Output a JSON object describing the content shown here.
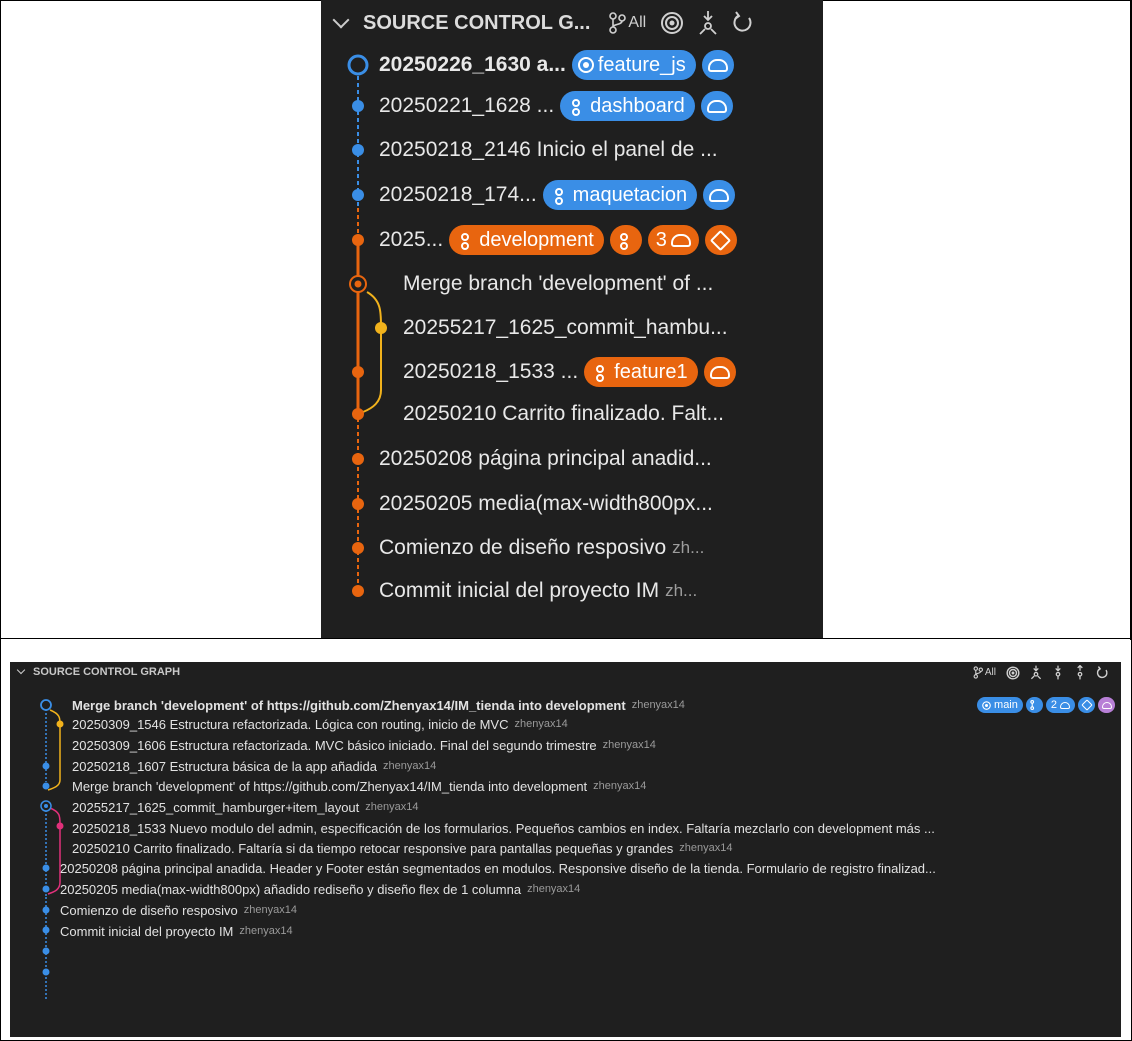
{
  "zoomed_panel": {
    "title": "SOURCE CONTROL G...",
    "all_label": "All",
    "commits": [
      {
        "message": "20250226_1630 a...",
        "author": "",
        "branch": "feature_js",
        "branch_color": "#3a8ee6",
        "marker": "head"
      },
      {
        "message": "20250221_1628 ...",
        "author": "",
        "branch": "dashboard",
        "branch_color": "#3a8ee6",
        "marker": "branch"
      },
      {
        "message": "20250218_2146 Inicio el panel de ...",
        "author": "",
        "branch": "",
        "branch_color": "",
        "marker": ""
      },
      {
        "message": "20250218_174...",
        "author": "",
        "branch": "maquetacion",
        "branch_color": "#3a8ee6",
        "marker": "branch"
      },
      {
        "message": "2025...",
        "author": "",
        "branch": "development",
        "branch_color": "#e8650f",
        "marker": "branch",
        "count": "3"
      },
      {
        "message": "Merge branch 'development' of ...",
        "author": "",
        "branch": "",
        "marker": ""
      },
      {
        "message": "20255217_1625_commit_hambu...",
        "author": "",
        "branch": "",
        "marker": ""
      },
      {
        "message": "20250218_1533 ...",
        "author": "",
        "branch": "feature1",
        "branch_color": "#e8650f",
        "marker": "branch"
      },
      {
        "message": "20250210 Carrito finalizado. Falt...",
        "author": "",
        "branch": "",
        "marker": ""
      },
      {
        "message": "20250208 página principal anadid...",
        "author": "",
        "branch": "",
        "marker": ""
      },
      {
        "message": "20250205 media(max-width800px...",
        "author": "",
        "branch": "",
        "marker": ""
      },
      {
        "message": "Comienzo de diseño resposivo",
        "author": "zh...",
        "branch": "",
        "marker": ""
      },
      {
        "message": "Commit inicial del proyecto IM",
        "author": "zh...",
        "branch": "",
        "marker": ""
      }
    ]
  },
  "full_panel": {
    "title": "SOURCE CONTROL GRAPH",
    "all_label": "All",
    "head_branch": "main",
    "count": "2",
    "commits": [
      {
        "message": "Merge branch 'development' of https://github.com/Zhenyax14/IM_tienda into development",
        "author": "zhenyax14",
        "bold": true
      },
      {
        "message": "20250309_1546 Estructura refactorizada. Lógica con routing, inicio de MVC",
        "author": "zhenyax14",
        "bold": false
      },
      {
        "message": "20250309_1606 Estructura refactorizada. MVC básico iniciado. Final del segundo trimestre",
        "author": "zhenyax14",
        "bold": false
      },
      {
        "message": "20250218_1607 Estructura básica de la app añadida",
        "author": "zhenyax14",
        "bold": false
      },
      {
        "message": "Merge branch 'development' of https://github.com/Zhenyax14/IM_tienda into development",
        "author": "zhenyax14",
        "bold": false
      },
      {
        "message": "20255217_1625_commit_hamburger+item_layout",
        "author": "zhenyax14",
        "bold": false
      },
      {
        "message": "20250218_1533 Nuevo modulo del admin, especificación de los formularios. Pequeños cambios en index. Faltaría mezclarlo con development más ...",
        "author": "",
        "bold": false
      },
      {
        "message": "20250210 Carrito finalizado. Faltaría si da tiempo retocar responsive para pantallas pequeñas y grandes",
        "author": "zhenyax14",
        "bold": false
      },
      {
        "message": "20250208 página principal anadida. Header y Footer están segmentados en modulos. Responsive diseño de la tienda. Formulario de registro finalizad...",
        "author": "",
        "bold": false
      },
      {
        "message": "20250205 media(max-width800px) añadido rediseño y diseño flex de 1 columna",
        "author": "zhenyax14",
        "bold": false
      },
      {
        "message": "Comienzo de diseño resposivo",
        "author": "zhenyax14",
        "bold": false
      },
      {
        "message": "Commit inicial del proyecto IM",
        "author": "zhenyax14",
        "bold": false
      }
    ]
  },
  "colors": {
    "blue": "#3a8ee6",
    "orange": "#e8650f",
    "yellow": "#f1b21c",
    "pink": "#e0307a",
    "purple": "#b87fd6",
    "background": "#1f1f1f"
  }
}
